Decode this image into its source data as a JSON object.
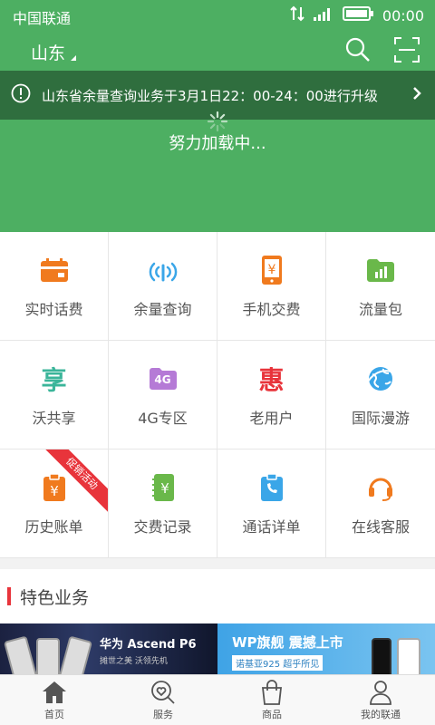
{
  "status_bar": {
    "carrier": "中国联通",
    "time": "00:00"
  },
  "header": {
    "city": "山东",
    "notice": "山东省余量查询业务于3月1日22：00-24：00进行升级",
    "loading_text": "努力加载中..."
  },
  "services": [
    {
      "label": "实时话费",
      "icon": "calendar-icon",
      "color": "#f07a1e"
    },
    {
      "label": "余量查询",
      "icon": "signal-gauge-icon",
      "color": "#3aa6e8"
    },
    {
      "label": "手机交费",
      "icon": "phone-yen-icon",
      "color": "#f07a1e"
    },
    {
      "label": "流量包",
      "icon": "data-folder-icon",
      "color": "#6ab84a"
    },
    {
      "label": "沃共享",
      "icon": "share-char-icon",
      "color": "#3bb59a",
      "glyph": "享"
    },
    {
      "label": "4G专区",
      "icon": "4g-folder-icon",
      "color": "#b57ad6",
      "glyph": "4G"
    },
    {
      "label": "老用户",
      "icon": "discount-char-icon",
      "color": "#e8343b",
      "glyph": "惠"
    },
    {
      "label": "国际漫游",
      "icon": "globe-plane-icon",
      "color": "#3aa6e8"
    },
    {
      "label": "历史账单",
      "icon": "clipboard-yen-icon",
      "color": "#f07a1e",
      "ribbon": "促销活动"
    },
    {
      "label": "交费记录",
      "icon": "notebook-yen-icon",
      "color": "#6ab84a"
    },
    {
      "label": "通话详单",
      "icon": "call-list-icon",
      "color": "#3aa6e8"
    },
    {
      "label": "在线客服",
      "icon": "headset-icon",
      "color": "#f07a1e"
    }
  ],
  "featured": {
    "title": "特色业务",
    "banner1": {
      "title": "华为 Ascend P6",
      "subtitle": "摊世之美 沃领先机"
    },
    "banner2": {
      "title": "WP旗舰 震撼上市",
      "subtitle": "诺基亚925 超乎所见"
    }
  },
  "tabs": [
    {
      "label": "首页",
      "icon": "home-icon"
    },
    {
      "label": "服务",
      "icon": "service-heart-icon"
    },
    {
      "label": "商品",
      "icon": "shopping-bag-icon"
    },
    {
      "label": "我的联通",
      "icon": "user-icon"
    }
  ],
  "colors": {
    "brand_green": "#4daf62",
    "notice_bg": "#2f6e3e",
    "accent_red": "#e8343b"
  }
}
